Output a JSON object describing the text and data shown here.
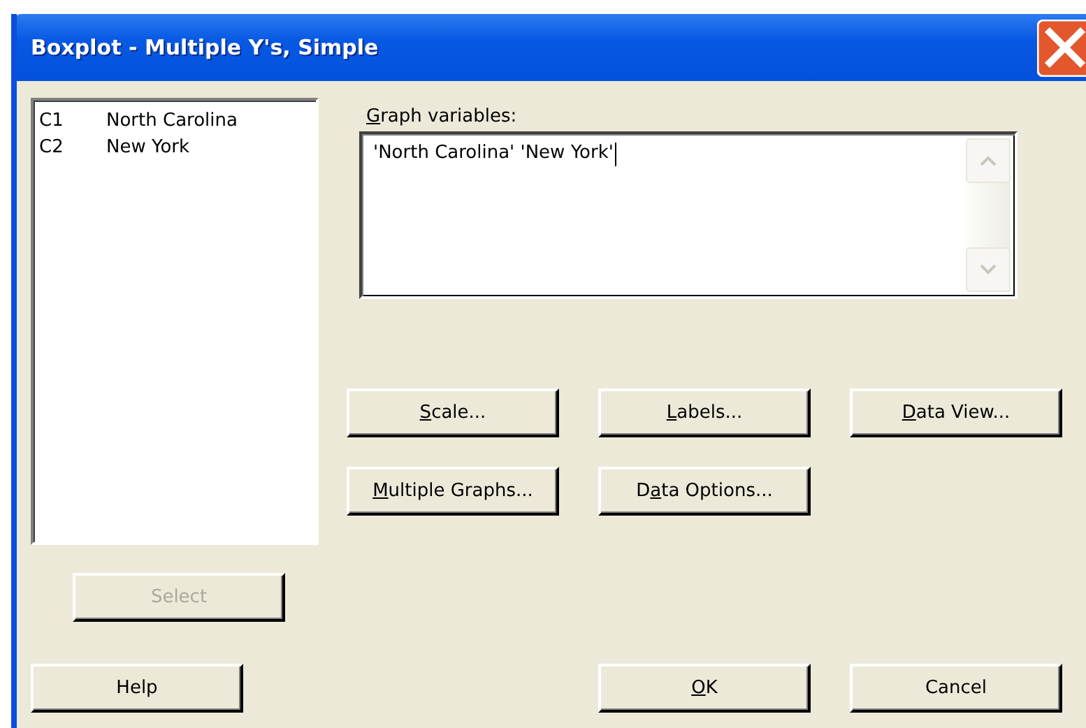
{
  "window": {
    "title": "Boxplot - Multiple Y's, Simple"
  },
  "column_list": [
    {
      "column": "C1",
      "name": "North Carolina"
    },
    {
      "column": "C2",
      "name": "New York"
    }
  ],
  "graph_variables": {
    "label": [
      {
        "text": "G",
        "underlined": true
      },
      {
        "text": "raph variables:",
        "underlined": false
      }
    ],
    "value": "'North Carolina' 'New York'"
  },
  "option_buttons": [
    {
      "label": [
        {
          "text": "S",
          "underlined": true
        },
        {
          "text": "cale...",
          "underlined": false
        }
      ]
    },
    {
      "label": [
        {
          "text": "L",
          "underlined": true
        },
        {
          "text": "abels...",
          "underlined": false
        }
      ]
    },
    {
      "label": [
        {
          "text": "D",
          "underlined": true
        },
        {
          "text": "ata View...",
          "underlined": false
        }
      ]
    },
    {
      "label": [
        {
          "text": "M",
          "underlined": true
        },
        {
          "text": "ultiple Graphs...",
          "underlined": false
        }
      ]
    },
    {
      "label": [
        {
          "text": "D",
          "underlined": false
        },
        {
          "text": "a",
          "underlined": true
        },
        {
          "text": "ta Options...",
          "underlined": false
        }
      ]
    }
  ],
  "select_button": {
    "label": [
      {
        "text": "Select",
        "underlined": false
      }
    ],
    "disabled": true
  },
  "help_button": {
    "label": [
      {
        "text": "Help",
        "underlined": false
      }
    ],
    "disabled": false
  },
  "ok_button": {
    "label": [
      {
        "text": "O",
        "underlined": true
      },
      {
        "text": "K",
        "underlined": false
      }
    ],
    "disabled": false
  },
  "cancel_button": {
    "label": [
      {
        "text": "Cancel",
        "underlined": false
      }
    ],
    "disabled": false
  }
}
